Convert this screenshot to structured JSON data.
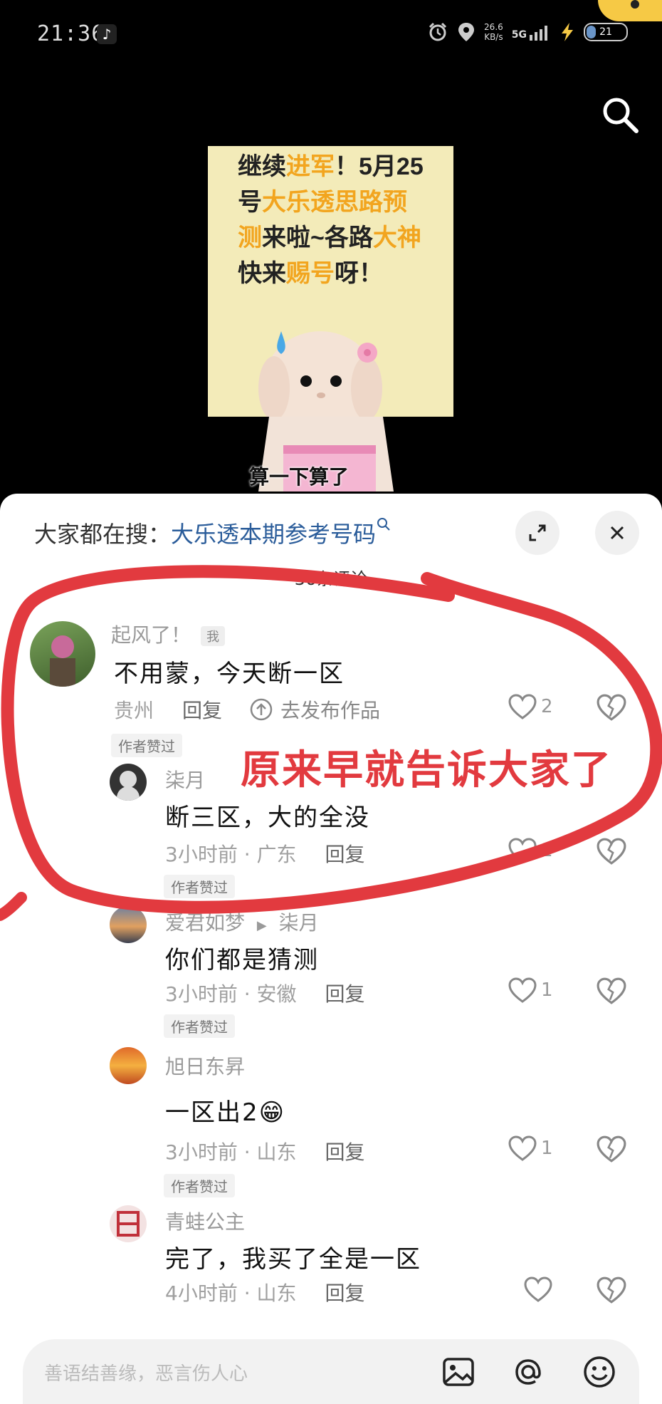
{
  "status_bar": {
    "time": "21:36",
    "net_speed_value": "26.6",
    "net_speed_unit": "KB/s",
    "network": "5G",
    "battery": "21"
  },
  "video": {
    "card_text_parts": [
      {
        "t": "继续",
        "hl": false
      },
      {
        "t": "进军",
        "hl": true
      },
      {
        "t": "！5月25号",
        "hl": false
      },
      {
        "t": "大乐透思路预测",
        "hl": true
      },
      {
        "t": "来啦~各路",
        "hl": false
      },
      {
        "t": "大神",
        "hl": true
      },
      {
        "t": "快来",
        "hl": false
      },
      {
        "t": "赐号",
        "hl": true
      },
      {
        "t": "呀！",
        "hl": false
      }
    ],
    "subtitle": "算一下算了"
  },
  "comments_sheet": {
    "search_prefix": "大家都在搜：",
    "search_keyword": "大乐透本期参考号码",
    "comment_count": "36条评论",
    "annotation": "原来早就告诉大家了"
  },
  "comments": [
    {
      "name": "起风了！",
      "tag": "我",
      "content": "不用蒙，今天断一区",
      "location": "贵州",
      "reply_label": "回复",
      "publish_label": "去发布作品",
      "likes": "2",
      "author_liked": "作者赞过"
    },
    {
      "name": "柒月",
      "content": "断三区，大的全没",
      "time_location": "3小时前 · 广东",
      "reply_label": "回复",
      "likes": "1",
      "author_liked": "作者赞过"
    },
    {
      "name": "爱君如梦",
      "reply_to": "柒月",
      "content": "你们都是猜测",
      "time_location": "3小时前 · 安徽",
      "reply_label": "回复",
      "likes": "1",
      "author_liked": "作者赞过"
    },
    {
      "name": "旭日东昇",
      "content": "一区出2😁",
      "time_location": "3小时前 · 山东",
      "reply_label": "回复",
      "likes": "1",
      "author_liked": "作者赞过"
    },
    {
      "name": "青蛙公主",
      "content": "完了，我买了全是一区",
      "time_location": "4小时前 · 山东",
      "reply_label": "回复",
      "likes": ""
    }
  ],
  "input_bar": {
    "placeholder": "善语结善缘，恶言伤人心"
  },
  "colors": {
    "highlight": "#f2a51f",
    "annotation_red": "#e23a3f",
    "search_keyword": "#2a5c9a"
  }
}
